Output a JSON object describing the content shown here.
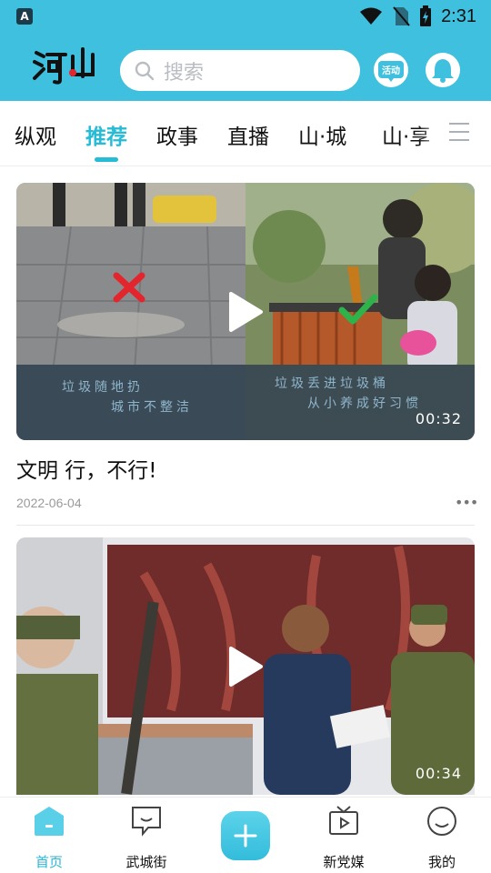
{
  "status_bar": {
    "time": "2:31",
    "app_badge": "A"
  },
  "header": {
    "logo_text": "河山",
    "search_placeholder": "搜索",
    "activity_label": "活动",
    "icons": {
      "search": "search-icon",
      "activity": "activity-icon",
      "bell": "bell-icon"
    }
  },
  "tabs": {
    "items": [
      "纵观",
      "推荐",
      "政事",
      "直播",
      "山·城",
      "山·享"
    ],
    "active_index": 1
  },
  "feed": [
    {
      "title": "文明  行，不行!",
      "date": "2022-06-04",
      "duration": "00:32",
      "thumb_caption_left": [
        "垃圾随地扔",
        "城市不整洁"
      ],
      "thumb_caption_right": [
        "垃圾丢进垃圾桶",
        "从小养成好习惯"
      ]
    },
    {
      "duration": "00:34"
    }
  ],
  "bottom_nav": {
    "items": [
      {
        "label": "首页",
        "icon": "home-icon"
      },
      {
        "label": "武城街",
        "icon": "chat-bubble-icon"
      },
      {
        "label": "新党媒",
        "icon": "tv-icon"
      },
      {
        "label": "我的",
        "icon": "smile-icon"
      }
    ],
    "active_index": 0
  },
  "colors": {
    "brand": "#3fc0de",
    "accent": "#27bcd6"
  }
}
